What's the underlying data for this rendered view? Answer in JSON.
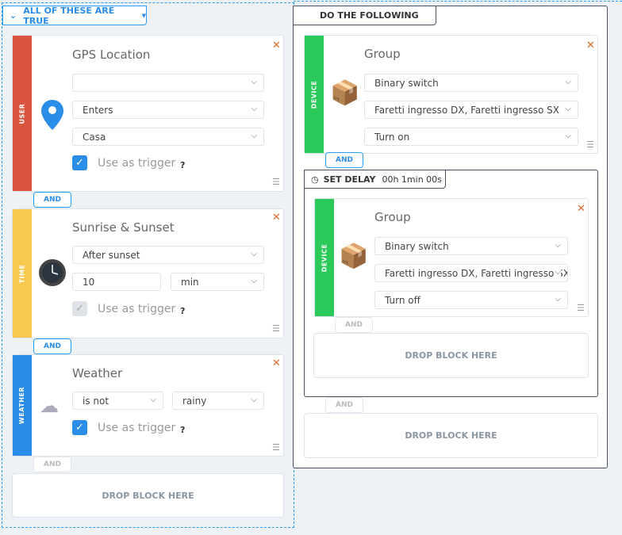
{
  "conditions": {
    "header": "ALL OF THESE ARE TRUE",
    "cards": [
      {
        "category": "USER",
        "color": "#d9553e",
        "title": "GPS Location",
        "icon": "map-pin-icon",
        "selects": [
          "",
          "Enters",
          "Casa"
        ],
        "trigger_label": "Use as trigger",
        "trigger_checked": true
      },
      {
        "category": "TIME",
        "color": "#f9c84f",
        "title": "Sunrise & Sunset",
        "icon": "clock-icon",
        "selects": [
          "After sunset"
        ],
        "offset_value": "10",
        "offset_unit": "min",
        "trigger_label": "Use as trigger",
        "trigger_checked": true,
        "trigger_disabled": true
      },
      {
        "category": "WEATHER",
        "color": "#2a8de8",
        "title": "Weather",
        "icon": "cloud-icon",
        "selects": [
          "is not",
          "rainy"
        ],
        "trigger_label": "Use as trigger",
        "trigger_checked": true
      }
    ],
    "and_label": "AND",
    "drop_label": "DROP BLOCK HERE"
  },
  "actions": {
    "header": "DO THE FOLLOWING",
    "cards": [
      {
        "category": "DEVICE",
        "color": "#2bc95a",
        "title": "Group",
        "icon": "box-icon",
        "selects": [
          "Binary switch",
          "Faretti ingresso DX, Faretti ingresso SX",
          "Turn on"
        ]
      },
      {
        "category": "DEVICE",
        "color": "#2bc95a",
        "title": "Group",
        "icon": "box-icon",
        "selects": [
          "Binary switch",
          "Faretti ingresso DX, Faretti ingresso SX",
          "Turn off"
        ]
      }
    ],
    "delay_label": "SET DELAY",
    "delay_value": "00h 1min 00s",
    "and_label": "AND",
    "drop_label": "DROP BLOCK HERE"
  },
  "help": "?"
}
